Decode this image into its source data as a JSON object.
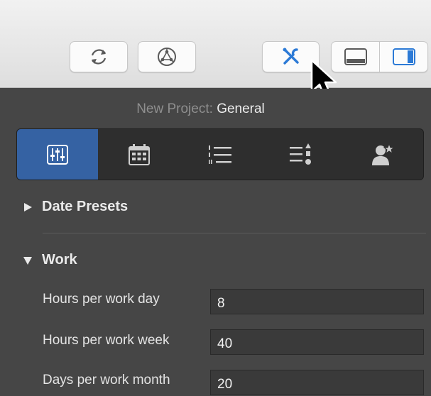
{
  "toolbar": {
    "buttons": [
      {
        "icon": "sync-icon"
      },
      {
        "icon": "share-icon"
      },
      {
        "icon": "tools-icon"
      }
    ],
    "view_segment": [
      {
        "icon": "bottom-panel-icon"
      },
      {
        "icon": "right-sidebar-icon"
      }
    ],
    "accent_color": "#2c7ad6"
  },
  "inspector": {
    "subtitle_prefix": "New Project:",
    "subtitle_name": "General",
    "tabs": [
      {
        "icon": "sliders-icon",
        "active": true
      },
      {
        "icon": "calendar-icon",
        "active": false
      },
      {
        "icon": "outline-list-icon",
        "active": false
      },
      {
        "icon": "priority-list-icon",
        "active": false
      },
      {
        "icon": "resource-star-icon",
        "active": false
      }
    ],
    "active_tab_color": "#3562a3",
    "sections": {
      "date_presets": {
        "label": "Date Presets",
        "expanded": false
      },
      "work": {
        "label": "Work",
        "expanded": true
      }
    },
    "work_fields": [
      {
        "label": "Hours per work day",
        "value": "8"
      },
      {
        "label": "Hours per work week",
        "value": "40"
      },
      {
        "label": "Days per work month",
        "value": "20"
      }
    ]
  }
}
